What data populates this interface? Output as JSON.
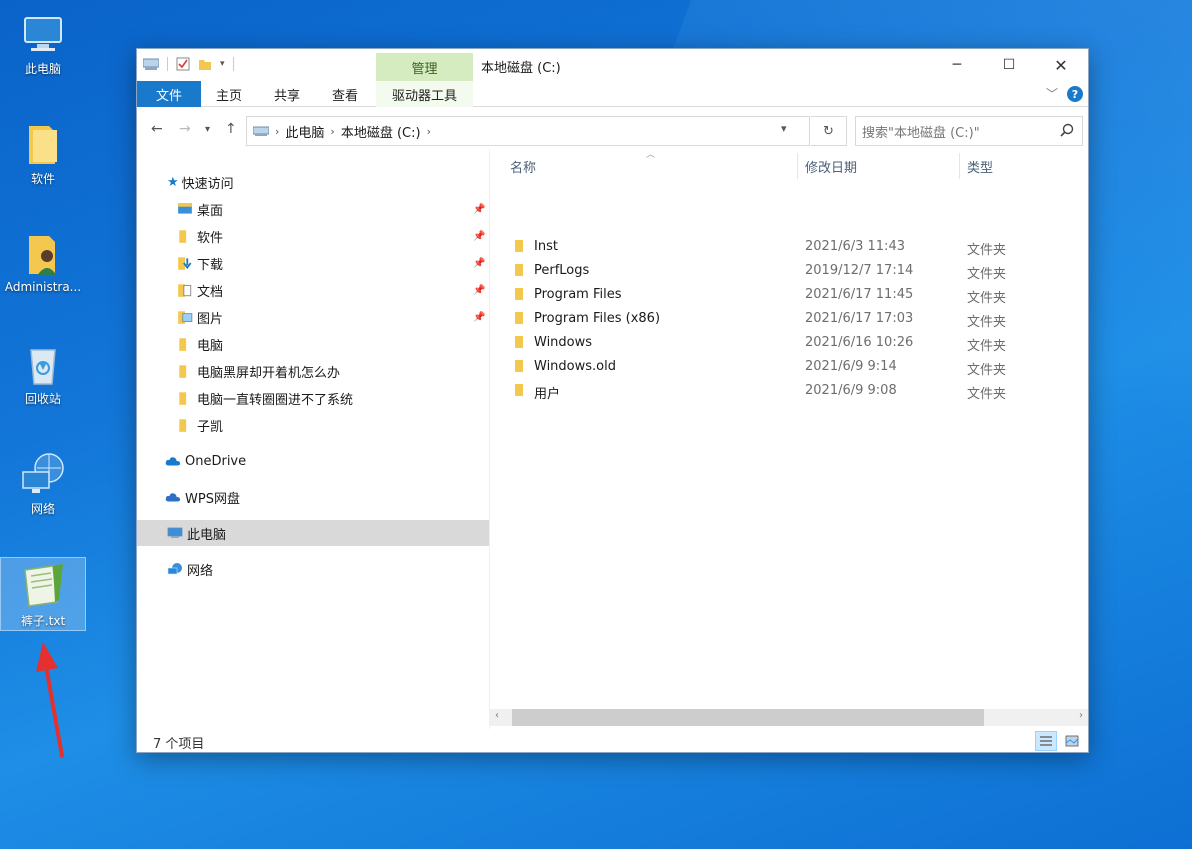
{
  "desktop": {
    "icons": [
      {
        "label": "此电脑"
      },
      {
        "label": "软件"
      },
      {
        "label": "Administra..."
      },
      {
        "label": "回收站"
      },
      {
        "label": "网络"
      },
      {
        "label": "裤子.txt"
      }
    ]
  },
  "window": {
    "title": "本地磁盘 (C:)",
    "manage_tab": "管理",
    "ribbon_tabs": [
      "文件",
      "主页",
      "共享",
      "查看",
      "驱动器工具"
    ],
    "help": "?"
  },
  "address": {
    "crumbs": [
      "此电脑",
      "本地磁盘 (C:)"
    ],
    "search_placeholder": "搜索\"本地磁盘 (C:)\""
  },
  "navpane": {
    "quick_access": "快速访问",
    "quick_items": [
      {
        "label": "桌面",
        "pinned": true
      },
      {
        "label": "软件",
        "pinned": true
      },
      {
        "label": "下载",
        "pinned": true
      },
      {
        "label": "文档",
        "pinned": true
      },
      {
        "label": "图片",
        "pinned": true
      },
      {
        "label": "电脑",
        "pinned": false
      },
      {
        "label": "电脑黑屏却开着机怎么办",
        "pinned": false
      },
      {
        "label": "电脑一直转圈圈进不了系统",
        "pinned": false
      },
      {
        "label": "子凯",
        "pinned": false
      }
    ],
    "onedrive": "OneDrive",
    "wps": "WPS网盘",
    "this_pc": "此电脑",
    "network": "网络"
  },
  "columns": {
    "name": "名称",
    "date": "修改日期",
    "type": "类型"
  },
  "files": [
    {
      "name": "Inst",
      "date": "2021/6/3 11:43",
      "type": "文件夹"
    },
    {
      "name": "PerfLogs",
      "date": "2019/12/7 17:14",
      "type": "文件夹"
    },
    {
      "name": "Program Files",
      "date": "2021/6/17 11:45",
      "type": "文件夹"
    },
    {
      "name": "Program Files (x86)",
      "date": "2021/6/17 17:03",
      "type": "文件夹"
    },
    {
      "name": "Windows",
      "date": "2021/6/16 10:26",
      "type": "文件夹"
    },
    {
      "name": "Windows.old",
      "date": "2021/6/9 9:14",
      "type": "文件夹"
    },
    {
      "name": "用户",
      "date": "2021/6/9 9:08",
      "type": "文件夹"
    }
  ],
  "status": {
    "item_count": "7 个项目"
  },
  "colors": {
    "accent": "#1979ca",
    "folder": "#f4c74f",
    "manage_bg": "#d4ecc0"
  }
}
